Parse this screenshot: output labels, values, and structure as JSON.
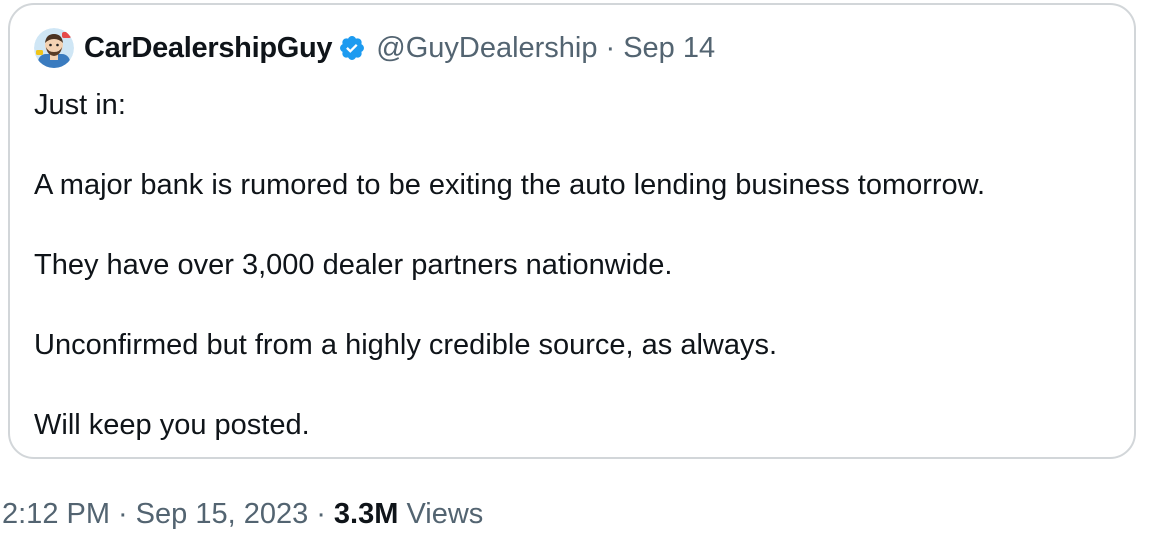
{
  "tweet": {
    "author": {
      "display_name": "CarDealershipGuy",
      "handle": "@GuyDealership",
      "verified": true,
      "avatar_icon": "avatar-cartoon-man"
    },
    "date": "Sep 14",
    "separator": "·",
    "paragraphs": [
      "Just in:",
      "A major bank is rumored to be exiting the auto lending business tomorrow.",
      "They have over 3,000 dealer partners nationwide.",
      "Unconfirmed but from a highly credible source, as always.",
      "Will keep you posted."
    ]
  },
  "footer": {
    "time": "2:12 PM",
    "date": "Sep 15, 2023",
    "separator": "·",
    "views_count": "3.3M",
    "views_label": "Views"
  },
  "colors": {
    "verified_badge": "#1d9bf0",
    "secondary_text": "#536471",
    "primary_text": "#0f1419",
    "border": "#d2d6d9"
  }
}
